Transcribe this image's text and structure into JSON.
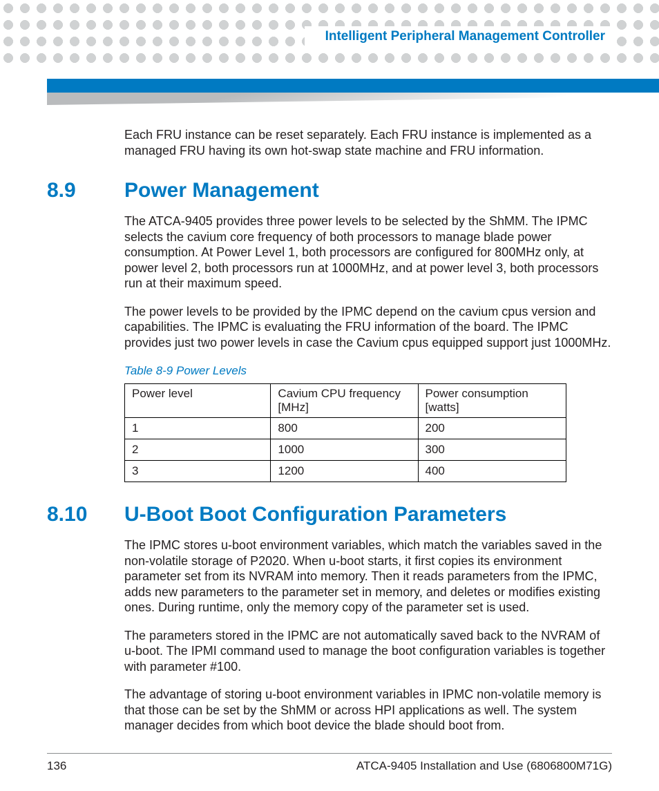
{
  "header": {
    "running_title": "Intelligent Peripheral Management Controller"
  },
  "intro_paragraph": "Each FRU instance can be reset separately. Each FRU instance is implemented as a managed FRU having its own hot-swap state machine and FRU information.",
  "section89": {
    "num": "8.9",
    "title": "Power Management",
    "p1": "The ATCA-9405 provides three power levels to be selected by the ShMM. The IPMC selects the cavium core frequency of both processors to manage blade power consumption. At Power Level 1, both processors are configured for 800MHz only, at power level 2, both processors run at 1000MHz, and at power level 3, both processors run at their maximum speed.",
    "p2": "The power levels to be provided by the IPMC depend on the cavium cpus version and capabilities. The IPMC is evaluating the FRU information of the board. The IPMC provides just two power levels in case the Cavium cpus equipped support just 1000MHz.",
    "table_caption": "Table 8-9 Power Levels",
    "table": {
      "headers": [
        "Power level",
        "Cavium CPU frequency [MHz]",
        "Power consumption [watts]"
      ],
      "rows": [
        [
          "1",
          "800",
          "200"
        ],
        [
          "2",
          "1000",
          "300"
        ],
        [
          "3",
          "1200",
          "400"
        ]
      ]
    }
  },
  "section810": {
    "num": "8.10",
    "title": "U-Boot Boot Configuration Parameters",
    "p1": "The IPMC stores u-boot environment variables, which match the variables saved in the non-volatile storage of P2020. When u-boot starts, it first copies its environment parameter set from its NVRAM into memory. Then it reads parameters from the IPMC, adds new parameters to the parameter set in memory, and deletes or modifies existing ones. During runtime, only the memory copy of the parameter set is used.",
    "p2": "The parameters stored in the IPMC are not automatically saved back to the NVRAM of u-boot. The IPMI command used to manage the boot configuration variables is                                          together with parameter #100.",
    "p3": "The advantage of storing u-boot environment variables in IPMC non-volatile memory is that those can be set by the ShMM or across HPI applications as well. The system manager decides from which boot device the blade should boot from."
  },
  "footer": {
    "page_number": "136",
    "doc_ref": "ATCA-9405 Installation and Use (6806800M71G)"
  },
  "chart_data": {
    "type": "table",
    "title": "Table 8-9 Power Levels",
    "columns": [
      "Power level",
      "Cavium CPU frequency [MHz]",
      "Power consumption [watts]"
    ],
    "rows": [
      {
        "Power level": 1,
        "Cavium CPU frequency [MHz]": 800,
        "Power consumption [watts]": 200
      },
      {
        "Power level": 2,
        "Cavium CPU frequency [MHz]": 1000,
        "Power consumption [watts]": 300
      },
      {
        "Power level": 3,
        "Cavium CPU frequency [MHz]": 1200,
        "Power consumption [watts]": 400
      }
    ]
  }
}
